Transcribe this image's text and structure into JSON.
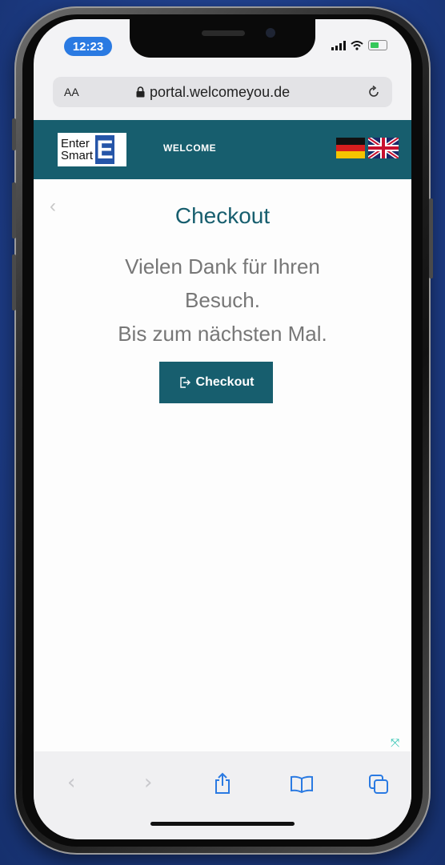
{
  "status_bar": {
    "time": "12:23"
  },
  "browser": {
    "text_size_label": "AA",
    "url": "portal.welcomeyou.de"
  },
  "site_header": {
    "logo_line1": "Enter",
    "logo_line2": "Smart",
    "logo_letter": "E",
    "nav_label": "WELCOME"
  },
  "page": {
    "title": "Checkout",
    "message_line1": "Vielen Dank für Ihren",
    "message_line2": "Besuch.",
    "message_line3": "Bis zum nächsten Mal.",
    "checkout_button": "Checkout"
  },
  "toolbar": {
    "icons": [
      "back-icon",
      "forward-icon",
      "share-icon",
      "bookmarks-icon",
      "tabs-icon"
    ]
  },
  "colors": {
    "header_teal": "#175e6e",
    "ios_blue": "#2a7ae2",
    "background_blue": "#1f3f8c"
  }
}
